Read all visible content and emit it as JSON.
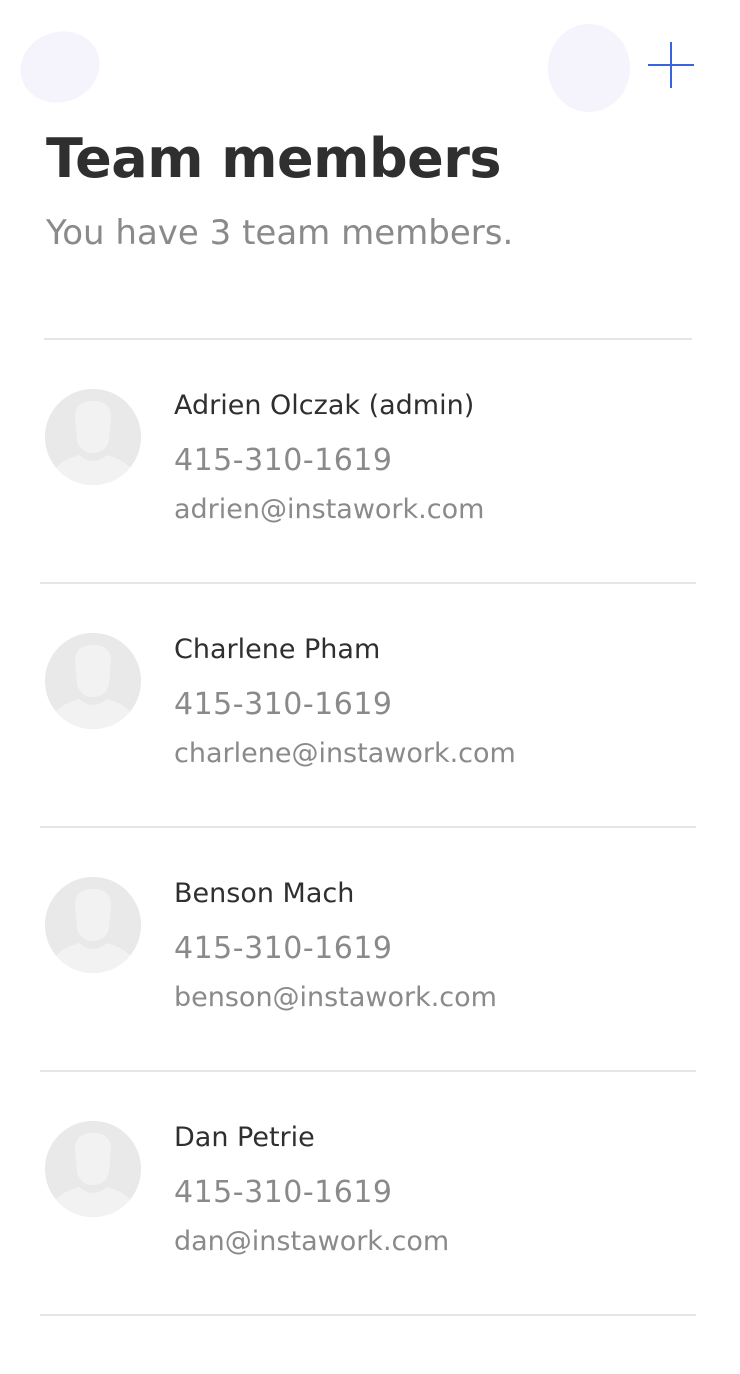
{
  "header": {
    "add_icon": "plus-icon",
    "accent_color": "#3b63e0"
  },
  "page": {
    "title": "Team members",
    "subtitle": "You have 3 team members."
  },
  "members": [
    {
      "name": "Adrien Olczak (admin)",
      "phone": "415-310-1619",
      "email": "adrien@instawork.com",
      "avatar_icon": "person-placeholder-icon"
    },
    {
      "name": "Charlene Pham",
      "phone": "415-310-1619",
      "email": "charlene@instawork.com",
      "avatar_icon": "person-placeholder-icon"
    },
    {
      "name": "Benson Mach",
      "phone": "415-310-1619",
      "email": "benson@instawork.com",
      "avatar_icon": "person-placeholder-icon"
    },
    {
      "name": "Dan Petrie",
      "phone": "415-310-1619",
      "email": "dan@instawork.com",
      "avatar_icon": "person-placeholder-icon"
    }
  ]
}
